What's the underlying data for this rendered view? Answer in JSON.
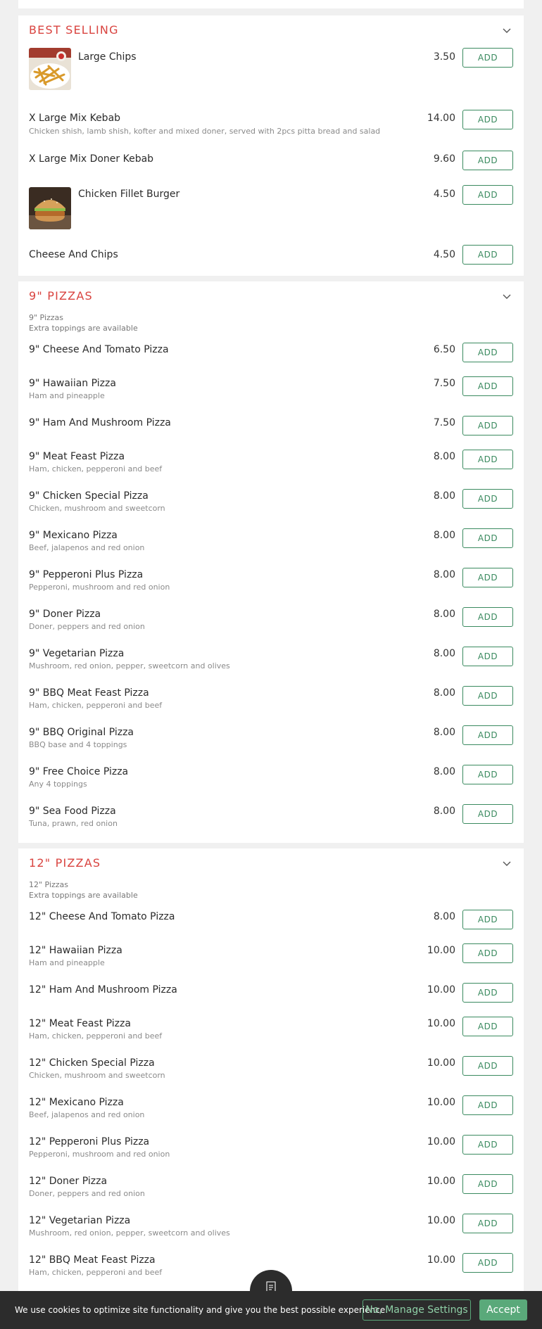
{
  "sections": [
    {
      "title": "BEST SELLING",
      "items": [
        {
          "name": "Large Chips",
          "price": "3.50",
          "add": "ADD",
          "image": "chips"
        },
        {
          "name": "X Large Mix Kebab",
          "desc": "Chicken shish, lamb shish, kofter and mixed doner, served with 2pcs pitta bread and salad",
          "price": "14.00",
          "add": "ADD"
        },
        {
          "name": "X Large Mix Doner Kebab",
          "price": "9.60",
          "add": "ADD"
        },
        {
          "name": "Chicken Fillet Burger",
          "price": "4.50",
          "add": "ADD",
          "image": "burger"
        },
        {
          "name": "Cheese And Chips",
          "price": "4.50",
          "add": "ADD"
        }
      ]
    },
    {
      "title": "9\" PIZZAS",
      "desc_line1": "9\" Pizzas",
      "desc_line2": "Extra toppings are available",
      "items": [
        {
          "name": "9\" Cheese And Tomato Pizza",
          "price": "6.50",
          "add": "ADD"
        },
        {
          "name": "9\" Hawaiian Pizza",
          "desc": "Ham and pineapple",
          "price": "7.50",
          "add": "ADD"
        },
        {
          "name": "9\" Ham And Mushroom Pizza",
          "price": "7.50",
          "add": "ADD"
        },
        {
          "name": "9\" Meat Feast Pizza",
          "desc": "Ham, chicken, pepperoni and beef",
          "price": "8.00",
          "add": "ADD"
        },
        {
          "name": "9\" Chicken Special Pizza",
          "desc": "Chicken, mushroom and sweetcorn",
          "price": "8.00",
          "add": "ADD"
        },
        {
          "name": "9\" Mexicano Pizza",
          "desc": "Beef, jalapenos and red onion",
          "price": "8.00",
          "add": "ADD"
        },
        {
          "name": "9\" Pepperoni Plus Pizza",
          "desc": "Pepperoni, mushroom and red onion",
          "price": "8.00",
          "add": "ADD"
        },
        {
          "name": "9\" Doner Pizza",
          "desc": "Doner, peppers and red onion",
          "price": "8.00",
          "add": "ADD"
        },
        {
          "name": "9\" Vegetarian Pizza",
          "desc": "Mushroom, red onion, pepper, sweetcorn and olives",
          "price": "8.00",
          "add": "ADD"
        },
        {
          "name": "9\" BBQ Meat Feast Pizza",
          "desc": "Ham, chicken, pepperoni and beef",
          "price": "8.00",
          "add": "ADD"
        },
        {
          "name": "9\" BBQ Original Pizza",
          "desc": "BBQ base and 4 toppings",
          "price": "8.00",
          "add": "ADD"
        },
        {
          "name": "9\" Free Choice Pizza",
          "desc": "Any 4 toppings",
          "price": "8.00",
          "add": "ADD"
        },
        {
          "name": "9\" Sea Food Pizza",
          "desc": "Tuna, prawn, red onion",
          "price": "8.00",
          "add": "ADD"
        }
      ]
    },
    {
      "title": "12\" PIZZAS",
      "desc_line1": "12\" Pizzas",
      "desc_line2": "Extra toppings are available",
      "items": [
        {
          "name": "12\" Cheese And Tomato Pizza",
          "price": "8.00",
          "add": "ADD"
        },
        {
          "name": "12\" Hawaiian Pizza",
          "desc": "Ham and pineapple",
          "price": "10.00",
          "add": "ADD"
        },
        {
          "name": "12\" Ham And Mushroom Pizza",
          "price": "10.00",
          "add": "ADD"
        },
        {
          "name": "12\" Meat Feast Pizza",
          "desc": "Ham, chicken, pepperoni and beef",
          "price": "10.00",
          "add": "ADD"
        },
        {
          "name": "12\" Chicken Special Pizza",
          "desc": "Chicken, mushroom and sweetcorn",
          "price": "10.00",
          "add": "ADD"
        },
        {
          "name": "12\" Mexicano Pizza",
          "desc": "Beef, jalapenos and red onion",
          "price": "10.00",
          "add": "ADD"
        },
        {
          "name": "12\" Pepperoni Plus Pizza",
          "desc": "Pepperoni, mushroom and red onion",
          "price": "10.00",
          "add": "ADD"
        },
        {
          "name": "12\" Doner Pizza",
          "desc": "Doner, peppers and red onion",
          "price": "10.00",
          "add": "ADD"
        },
        {
          "name": "12\" Vegetarian Pizza",
          "desc": "Mushroom, red onion, pepper, sweetcorn and olives",
          "price": "10.00",
          "add": "ADD"
        },
        {
          "name": "12\" BBQ Meat Feast Pizza",
          "desc": "Ham, chicken, pepperoni and beef",
          "price": "10.00",
          "add": "ADD"
        }
      ]
    }
  ],
  "cart_button": {
    "icon": "receipt-icon"
  },
  "cookie_banner": {
    "text": "We use cookies to optimize site functionality and give you the best possible experience.",
    "manage_label": "No, Manage Settings",
    "accept_label": "Accept"
  },
  "colors": {
    "accent_red": "#d9433f",
    "accent_green": "#3a8a5f",
    "banner_bg": "#2c2c2c"
  }
}
